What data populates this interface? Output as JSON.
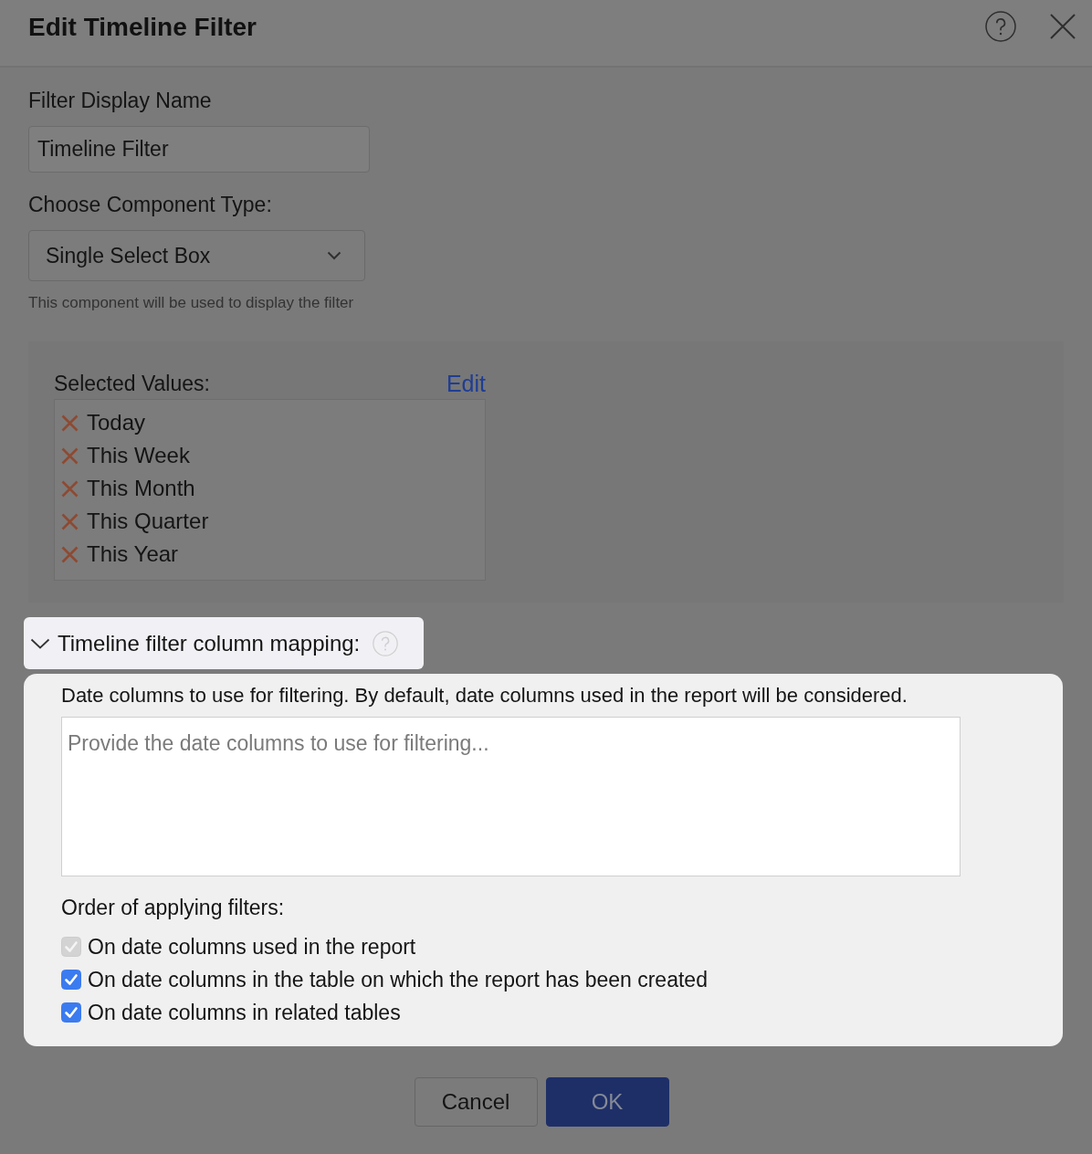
{
  "dialog": {
    "title": "Edit Timeline Filter"
  },
  "display_name": {
    "label": "Filter Display Name",
    "value": "Timeline Filter"
  },
  "component_type": {
    "label": "Choose Component Type:",
    "value": "Single Select Box",
    "hint": "This component will be used to display the filter"
  },
  "selected_values": {
    "label": "Selected Values:",
    "edit_link": "Edit",
    "items": [
      "Today",
      "This Week",
      "This Month",
      "This Quarter",
      "This Year"
    ]
  },
  "column_mapping": {
    "title": "Timeline filter column mapping:",
    "expanded": true,
    "highlighted": true,
    "description": "Date columns to use for filtering. By default, date columns used in the report will be considered.",
    "placeholder": "Provide the date columns to use for filtering...",
    "order_label": "Order of applying filters:",
    "options": [
      {
        "label": "On date columns used in the report",
        "checked": true,
        "disabled": true
      },
      {
        "label": "On date columns in the table on which the report has been created",
        "checked": true,
        "disabled": false
      },
      {
        "label": "On date columns in related tables",
        "checked": true,
        "disabled": false
      }
    ]
  },
  "buttons": [
    {
      "label": "Cancel",
      "kind": "secondary"
    },
    {
      "label": "OK",
      "kind": "primary"
    }
  ]
}
